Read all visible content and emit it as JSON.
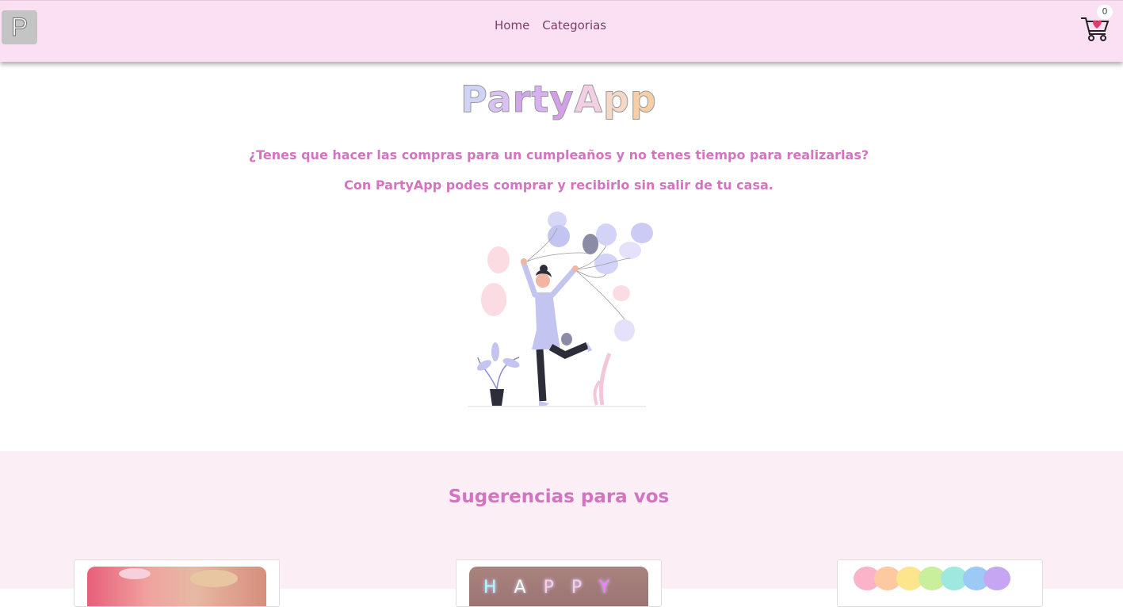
{
  "header": {
    "brand_letter": "P",
    "nav": [
      {
        "label": "Home"
      },
      {
        "label": "Categorias"
      }
    ],
    "cart_count": "0"
  },
  "hero": {
    "logo_parts": [
      "P",
      "a",
      "r",
      "t",
      "y",
      "A",
      "p",
      "p"
    ],
    "logo_colors": [
      "#cfd3f5",
      "#d9c2f3",
      "#cfa6ee",
      "#d8b1f0",
      "#d3a0e8",
      "#f3cfe4",
      "#f5d7c7",
      "#f7cfa6"
    ],
    "tagline_1": "¿Tenes que hacer las compras para un cumpleaños y no tenes tiempo para realizarlas?",
    "tagline_2": "Con PartyApp podes comprar y recibirlo sin salir de tu casa.",
    "illustration": "woman-with-balloons-illustration"
  },
  "suggestions": {
    "title": "Sugerencias para vos",
    "cards": [
      {
        "image": "pink-cookies-image"
      },
      {
        "image": "neon-happy-sign-image"
      },
      {
        "image": "pastel-heart-balloons-image"
      }
    ]
  },
  "colors": {
    "navbar_bg": "#fbdff3",
    "accent": "#d473c0",
    "section_bg": "#fbeef5"
  }
}
